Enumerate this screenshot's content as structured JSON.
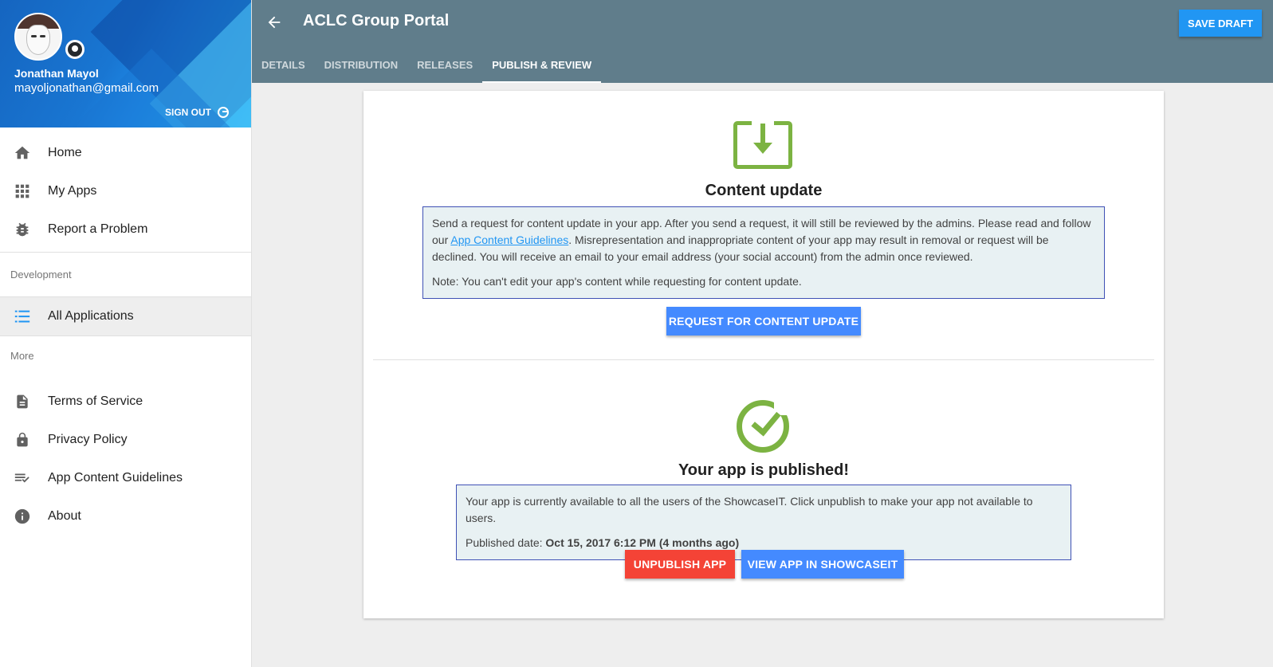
{
  "profile": {
    "name": "Jonathan Mayol",
    "email": "mayoljonathan@gmail.com",
    "sign_out": "SIGN OUT"
  },
  "sidebar": {
    "primary": [
      {
        "label": "Home",
        "icon": "home-icon"
      },
      {
        "label": "My Apps",
        "icon": "apps-grid-icon"
      },
      {
        "label": "Report a Problem",
        "icon": "bug-icon"
      }
    ],
    "development_label": "Development",
    "development": [
      {
        "label": "All Applications",
        "icon": "list-icon",
        "active": true
      }
    ],
    "more_label": "More",
    "more": [
      {
        "label": "Terms of Service",
        "icon": "document-icon"
      },
      {
        "label": "Privacy Policy",
        "icon": "lock-icon"
      },
      {
        "label": "App Content Guidelines",
        "icon": "checklist-icon"
      },
      {
        "label": "About",
        "icon": "info-icon"
      }
    ]
  },
  "header": {
    "title": "ACLC Group Portal",
    "save_draft": "SAVE DRAFT",
    "tabs": [
      {
        "label": "DETAILS"
      },
      {
        "label": "DISTRIBUTION"
      },
      {
        "label": "RELEASES"
      },
      {
        "label": "PUBLISH & REVIEW",
        "active": true
      }
    ]
  },
  "content_update": {
    "title": "Content update",
    "text_before_link": "Send a request for content update in your app. After you send a request, it will still be reviewed by the admins. Please read and follow our ",
    "link": "App Content Guidelines",
    "text_after_link": ". Misrepresentation and inappropriate content of your app may result in removal or request will be declined. You will receive an email to your email address (your social account) from the admin once reviewed.",
    "note": "Note: You can't edit your app's content while requesting for content update.",
    "button": "REQUEST FOR CONTENT UPDATE"
  },
  "published": {
    "title": "Your app is published!",
    "text": "Your app is currently available to all the users of the ShowcaseIT. Click unpublish to make your app not available to users.",
    "date_label": "Published date: ",
    "date_value": "Oct 15, 2017 6:12 PM (4 months ago)",
    "unpublish_button": "UNPUBLISH APP",
    "view_button": "VIEW APP IN SHOWCASEIT"
  },
  "colors": {
    "toolbar": "#607d8b",
    "accent": "#448aff",
    "success": "#7cb342",
    "danger": "#f44336"
  }
}
